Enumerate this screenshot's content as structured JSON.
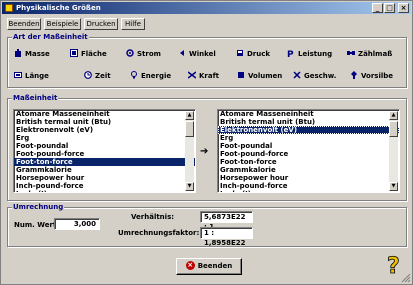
{
  "window": {
    "title": "Physikalische Größen"
  },
  "toolbar": {
    "beenden": "Beenden",
    "beispiele": "Beispiele",
    "drucken": "Drucken",
    "hilfe": "Hilfe"
  },
  "quantity_group": {
    "label": "Art der Maßeinheit",
    "buttons": [
      {
        "label": "Masse",
        "icon": "weight-icon"
      },
      {
        "label": "Fläche",
        "icon": "area-icon"
      },
      {
        "label": "Strom",
        "icon": "current-icon"
      },
      {
        "label": "Winkel",
        "icon": "angle-icon"
      },
      {
        "label": "Druck",
        "icon": "pressure-icon"
      },
      {
        "label": "Leistung",
        "icon": "power-icon"
      },
      {
        "label": "Zählmaß",
        "icon": "count-icon"
      },
      {
        "label": "Länge",
        "icon": "length-icon"
      },
      {
        "label": "Zeit",
        "icon": "clock-icon"
      },
      {
        "label": "Energie",
        "icon": "bulb-icon"
      },
      {
        "label": "Kraft",
        "icon": "force-icon"
      },
      {
        "label": "Volumen",
        "icon": "cube-icon"
      },
      {
        "label": "Geschw.",
        "icon": "speed-icon"
      },
      {
        "label": "Vorsilbe",
        "icon": "prefix-icon"
      }
    ]
  },
  "unit_group": {
    "label": "Maßeinheit",
    "units": [
      "Atomare Masseneinheit",
      "British termal unit (Btu)",
      "Elektronenvolt (eV)",
      "Erg",
      "Foot-poundal",
      "Foot-pound-force",
      "Foot-ton-force",
      "Grammkalorie",
      "Horsepower hour",
      "Inch-pound-force",
      "Joule (J)"
    ],
    "left_selected": "Foot-ton-force",
    "right_selected": "Elektronenvolt (eV)",
    "arrow": "➔"
  },
  "conversion": {
    "label": "Umrechnung",
    "num_label": "Num. Wert:",
    "num_value": "3,000",
    "ratio_label": "Verhältnis:",
    "ratio_value": "5,6873E22 : 1",
    "factor_label": "Umrechnungsfaktor:",
    "factor_value": "1 : 1,8958E22"
  },
  "footer": {
    "end_label": "Beenden",
    "help_symbol": "?"
  }
}
